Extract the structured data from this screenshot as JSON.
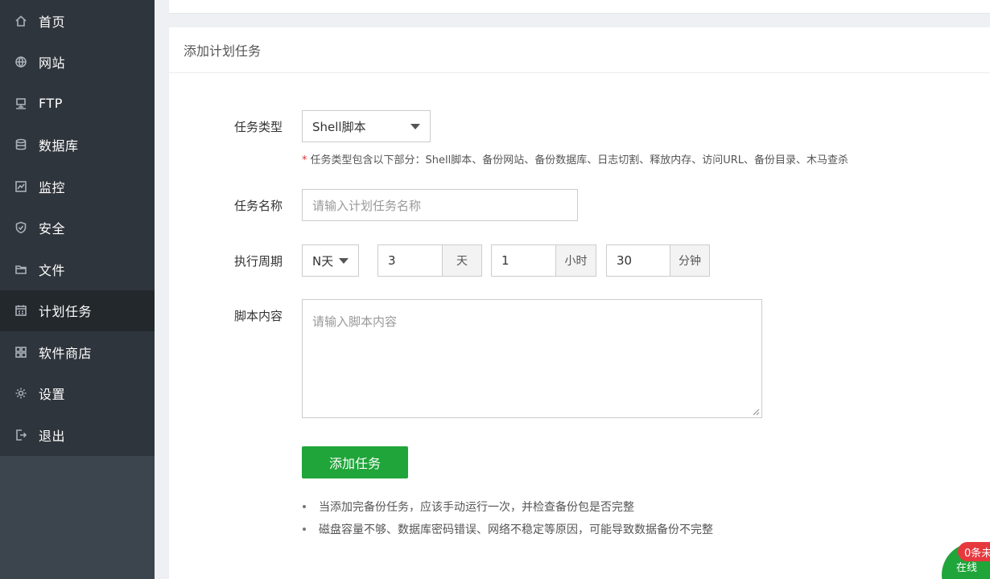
{
  "sidebar": {
    "items": [
      {
        "label": "首页",
        "icon": "home-icon"
      },
      {
        "label": "网站",
        "icon": "globe-icon"
      },
      {
        "label": "FTP",
        "icon": "ftp-icon"
      },
      {
        "label": "数据库",
        "icon": "database-icon"
      },
      {
        "label": "监控",
        "icon": "monitor-icon"
      },
      {
        "label": "安全",
        "icon": "shield-icon"
      },
      {
        "label": "文件",
        "icon": "folder-icon"
      },
      {
        "label": "计划任务",
        "icon": "calendar-icon",
        "active": true
      },
      {
        "label": "软件商店",
        "icon": "grid-icon"
      },
      {
        "label": "设置",
        "icon": "gear-icon"
      },
      {
        "label": "退出",
        "icon": "logout-icon"
      }
    ]
  },
  "panel": {
    "title": "添加计划任务"
  },
  "form": {
    "task_type": {
      "label": "任务类型",
      "value": "Shell脚本"
    },
    "tip_star": "*",
    "tip": "任务类型包含以下部分：Shell脚本、备份网站、备份数据库、日志切割、释放内存、访问URL、备份目录、木马查杀",
    "task_name": {
      "label": "任务名称",
      "placeholder": "请输入计划任务名称"
    },
    "period": {
      "label": "执行周期",
      "mode": "N天",
      "days": "3",
      "days_unit": "天",
      "hours": "1",
      "hours_unit": "小时",
      "minutes": "30",
      "minutes_unit": "分钟"
    },
    "script": {
      "label": "脚本内容",
      "placeholder": "请输入脚本内容"
    },
    "submit_label": "添加任务"
  },
  "notes": [
    "当添加完备份任务，应该手动运行一次，并检查备份包是否完整",
    "磁盘容量不够、数据库密码错误、网络不稳定等原因，可能导致数据备份不完整"
  ],
  "float": {
    "badge": "0条未",
    "chat_text": "在线"
  },
  "colors": {
    "sidebar_bg": "#3c444d",
    "menu_bg": "#2f353c",
    "active_bg": "#23282d",
    "primary": "#20a53a",
    "badge": "#e6393e"
  }
}
